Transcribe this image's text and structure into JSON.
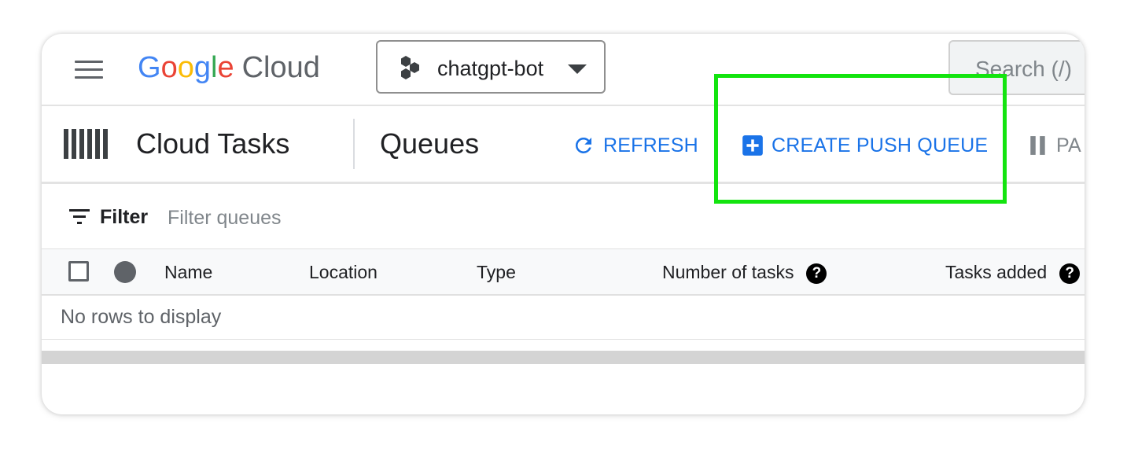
{
  "topbar": {
    "logo_google_letters": [
      "G",
      "o",
      "o",
      "g",
      "l",
      "e"
    ],
    "logo_product": "Cloud",
    "project_name": "chatgpt-bot",
    "search_placeholder": "Search (/)"
  },
  "productbar": {
    "product_title": "Cloud Tasks",
    "page_title": "Queues",
    "refresh_label": "REFRESH",
    "create_label": "CREATE PUSH QUEUE",
    "pause_label": "PA"
  },
  "filter": {
    "label": "Filter",
    "placeholder": "Filter queues"
  },
  "table": {
    "columns": [
      "Name",
      "Location",
      "Type",
      "Number of tasks",
      "Tasks added"
    ],
    "help_glyph": "?",
    "empty_message": "No rows to display"
  },
  "colors": {
    "accent": "#1a73e8",
    "highlight_box": "#13e40f",
    "google_blue": "#4285f4",
    "google_red": "#ea4335",
    "google_yellow": "#fbbc05",
    "google_green": "#34a853"
  },
  "icons": {
    "menu": "hamburger-icon",
    "project": "project-hexagons-icon",
    "dropdown": "caret-down-icon",
    "product": "cloud-tasks-icon",
    "refresh": "refresh-icon",
    "create": "add-box-icon",
    "pause": "pause-icon",
    "filter": "filter-list-icon",
    "help": "help-circle-icon"
  }
}
